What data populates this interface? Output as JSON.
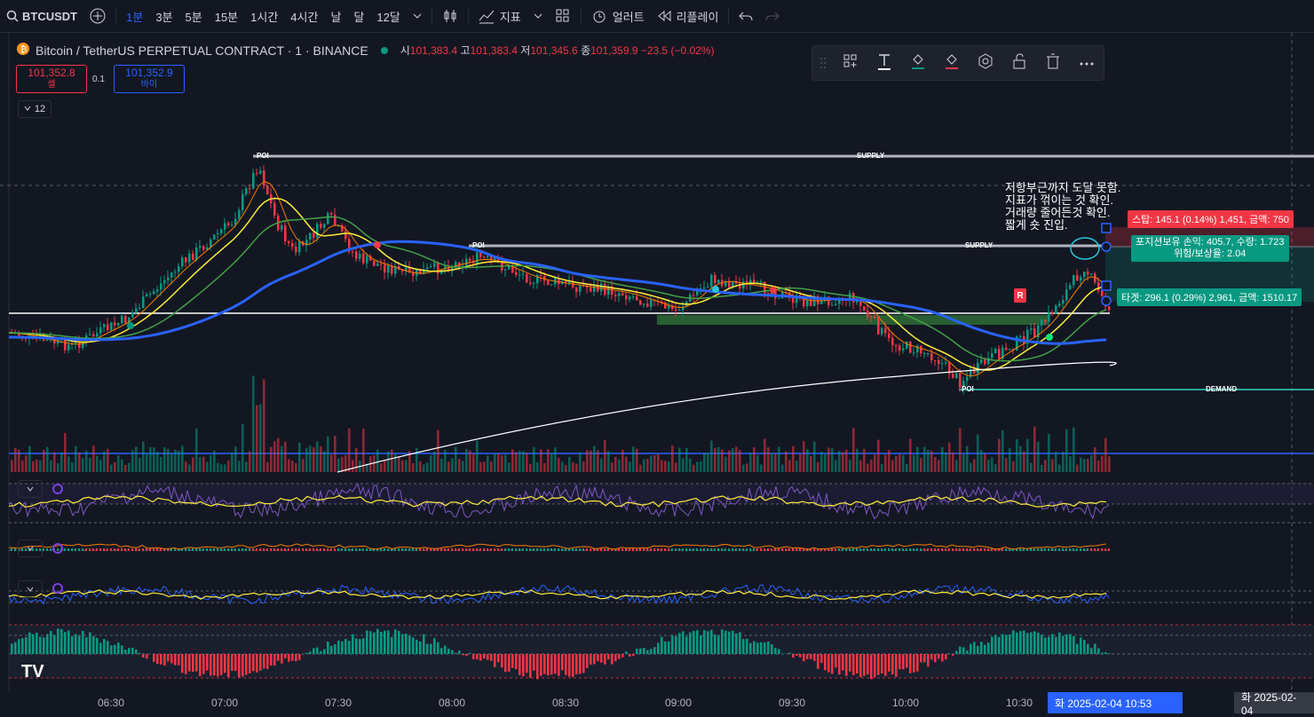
{
  "toolbar": {
    "symbol": "BTCUSDT",
    "intervals": [
      "1분",
      "3분",
      "5분",
      "15분",
      "1시간",
      "4시간",
      "날",
      "달",
      "12달"
    ],
    "active_interval": "1분",
    "indicators": "지표",
    "alert": "얼러트",
    "replay": "리플레이"
  },
  "legend": {
    "title": "Bitcoin / TetherUS PERPETUAL CONTRACT · 1 · BINANCE",
    "open_label": "시",
    "open": "101,383.4",
    "high_label": "고",
    "high": "101,383.4",
    "low_label": "저",
    "low": "101,345.6",
    "close_label": "종",
    "close": "101,359.9",
    "change": "−23.5 (−0.02%)"
  },
  "trade": {
    "sell_price": "101,352.8",
    "sell_label": "셀",
    "qty": "0.1",
    "buy_price": "101,352.9",
    "buy_label": "바이"
  },
  "collapse_count": "12",
  "position": {
    "stop": "스탑: 145.1 (0.14%) 1,451, 금액: 750",
    "line1": "포지션보유 손익: 405.7, 수량: 1.723",
    "line2": "위험/보상율: 2.04",
    "target": "타겟: 296.1 (0.29%) 2,961, 금액: 1510.17"
  },
  "note": "저항부근까지 도달 못함.\n지표가 꺾이는 것 확인.\n거래량 줄어든것 확인.\n짧게 숏 진입.",
  "zones": {
    "poi_top": "POI",
    "supply_top": "SUPPLY",
    "poi_mid": "POI",
    "supply_mid": "SUPPLY",
    "poi_bottom": "POI",
    "demand": "DEMAND",
    "r_marker": "R"
  },
  "time_axis": [
    "06:30",
    "07:00",
    "07:30",
    "08:00",
    "08:30",
    "09:00",
    "09:30",
    "10:00",
    "10:30"
  ],
  "date_badge": "화 2025-02-04   10:53",
  "date_badge_right": "화 2025-02-04",
  "logo": "TV",
  "colors": {
    "up": "#089981",
    "down": "#f23645",
    "ema_fast": "#ffeb3b",
    "ema_mid": "#43a047",
    "ema_slow": "#2962ff",
    "accent": "#2962ff"
  }
}
